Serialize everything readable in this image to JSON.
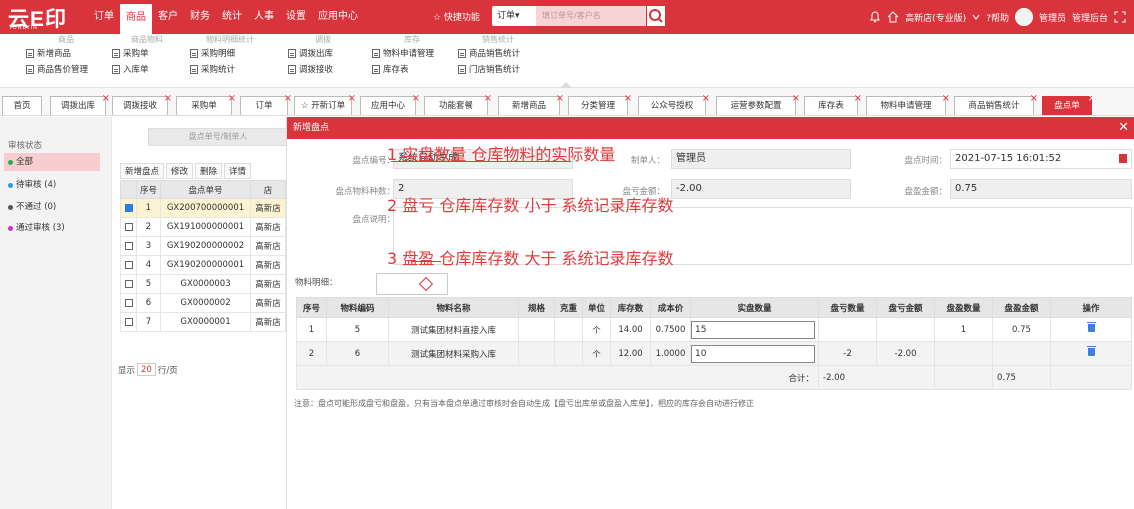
{
  "app": {
    "logo": "云E印",
    "logo_sub": "YUNEYIN"
  },
  "nav": [
    "订单",
    "商品",
    "客户",
    "财务",
    "统计",
    "人事",
    "设置",
    "应用中心"
  ],
  "header": {
    "quick": "☆ 快捷功能",
    "order_select": "订单▾",
    "search_placeholder": "填订单号/客户名",
    "store": "高新店(专业版)",
    "help": "?帮助",
    "admin": "管理员",
    "backend": "管理后台"
  },
  "submenu": [
    {
      "title": "商品",
      "items": [
        "新增商品",
        "商品售价管理"
      ]
    },
    {
      "title": "商品物料",
      "items": [
        "采购单",
        "入库单"
      ]
    },
    {
      "title": "物料明细统计",
      "items": [
        "采购明细",
        "采购统计"
      ]
    },
    {
      "title": "调拨",
      "items": [
        "调拨出库",
        "调拨接收"
      ]
    },
    {
      "title": "库存",
      "items": [
        "物料申请管理",
        "库存表"
      ]
    },
    {
      "title": "销售统计",
      "items": [
        "商品销售统计",
        "门店销售统计"
      ]
    }
  ],
  "tabs": [
    "首页",
    "调拨出库",
    "调拨接收",
    "采购单",
    "订单",
    "☆ 开新订单",
    "应用中心",
    "功能套餐",
    "新增商品",
    "分类管理",
    "公众号授权",
    "运营参数配置",
    "库存表",
    "物料申请管理",
    "商品销售统计",
    "盘点单"
  ],
  "filter": {
    "title": "审核状态",
    "items": [
      {
        "label": "全部",
        "color": "#22b14c"
      },
      {
        "label": "待审核 (4)",
        "color": "#2b9be0"
      },
      {
        "label": "不通过 (0)",
        "color": "#555555"
      },
      {
        "label": "通过审核 (3)",
        "color": "#d62ccd"
      }
    ]
  },
  "list": {
    "search_placeholder": "盘点单号/制单人",
    "toolbar": [
      "新增盘点",
      "修改",
      "删除",
      "详情"
    ],
    "headers": [
      "序号",
      "盘点单号",
      "店"
    ],
    "rows": [
      {
        "no": "1",
        "code": "GX200700000001",
        "store": "高新店"
      },
      {
        "no": "2",
        "code": "GX191000000001",
        "store": "高新店"
      },
      {
        "no": "3",
        "code": "GX190200000002",
        "store": "高新店"
      },
      {
        "no": "4",
        "code": "GX190200000001",
        "store": "高新店"
      },
      {
        "no": "5",
        "code": "GX0000003",
        "store": "高新店"
      },
      {
        "no": "6",
        "code": "GX0000002",
        "store": "高新店"
      },
      {
        "no": "7",
        "code": "GX0000001",
        "store": "高新店"
      }
    ],
    "pager": {
      "prefix": "显示",
      "size": "20",
      "suffix": "行/页"
    }
  },
  "modal": {
    "title": "新增盘点",
    "fields": {
      "code_label": "盘点编号：",
      "code_value": "系统自动生成",
      "maker_label": "制单人：",
      "maker_value": "管理员",
      "time_label": "盘点时间：",
      "time_value": "2021-07-15 16:01:52",
      "kinds_label": "盘点物料种数：",
      "kinds_value": "2",
      "loss_amount_label": "盘亏金额：",
      "loss_amount_value": "-2.00",
      "gain_amount_label": "盘盈金额：",
      "gain_amount_value": "0.75",
      "desc_label": "盘点说明：",
      "detail_label": "物料明细："
    },
    "annotations": [
      "1 实盘数量  仓库物料的实际数量",
      "2 盘亏   仓库库存数 小于  系统记录库存数",
      "3 盘盈   仓库库存数  大于  系统记录库存数"
    ],
    "table_headers": [
      "序号",
      "物料编码",
      "物料名称",
      "规格",
      "克重",
      "单位",
      "库存数",
      "成本价",
      "实盘数量",
      "盘亏数量",
      "盘亏金额",
      "盘盈数量",
      "盘盈金额",
      "操作"
    ],
    "rows": [
      {
        "no": "1",
        "code": "5",
        "name": "测试集团材料直接入库",
        "spec": "",
        "weight": "",
        "unit": "个",
        "stock": "14.00",
        "cost": "0.7500",
        "actual": "15",
        "loss_qty": "",
        "loss_amt": "",
        "gain_qty": "1",
        "gain_amt": "0.75"
      },
      {
        "no": "2",
        "code": "6",
        "name": "测试集团材料采购入库",
        "spec": "",
        "weight": "",
        "unit": "个",
        "stock": "12.00",
        "cost": "1.0000",
        "actual": "10",
        "loss_qty": "-2",
        "loss_amt": "-2.00",
        "gain_qty": "",
        "gain_amt": ""
      }
    ],
    "total_label": "合计：",
    "total_loss": "-2.00",
    "total_gain": "0.75",
    "note": "注意：盘点可能形成盘亏和盘盈，只有当本盘点单通过审核时会自动生成【盘亏出库单或盘盈入库单】，相应的库存会自动进行修正"
  }
}
